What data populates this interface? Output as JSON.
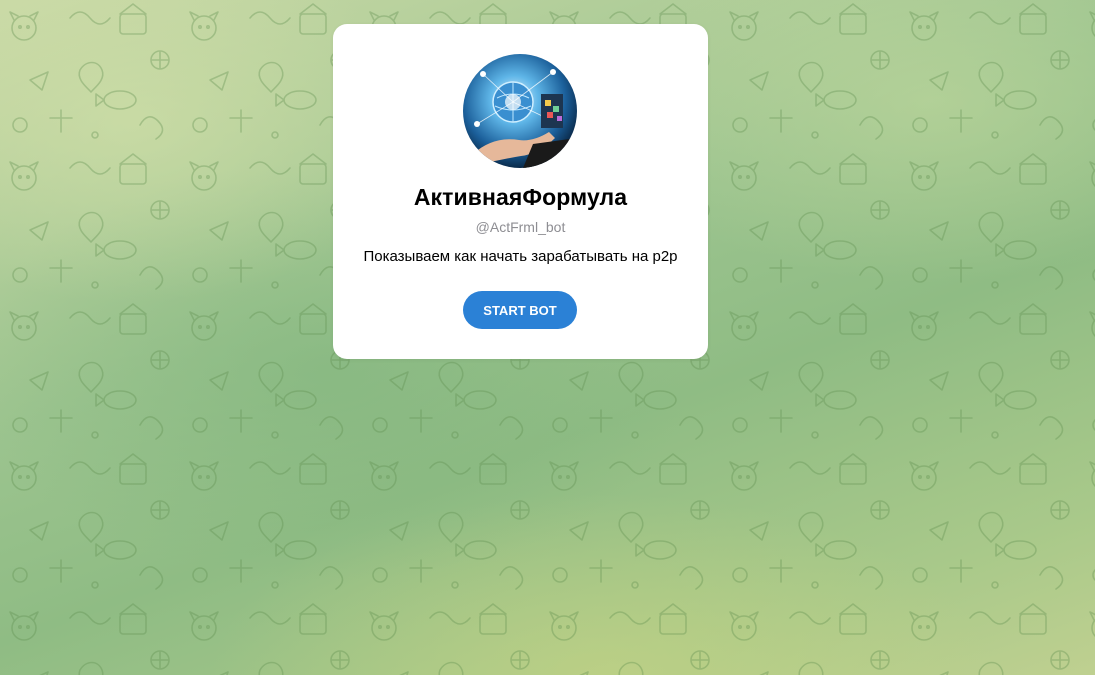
{
  "bot": {
    "name": "АктивнаяФормула",
    "username": "@ActFrml_bot",
    "description": "Показываем как начать зарабатывать на p2p",
    "start_label": "START BOT"
  },
  "colors": {
    "accent": "#2b81d6",
    "card": "#ffffff",
    "username": "#8e8e93"
  },
  "icons": {
    "background": "telegram-doodle-pattern",
    "avatar": "bot-avatar-image"
  }
}
